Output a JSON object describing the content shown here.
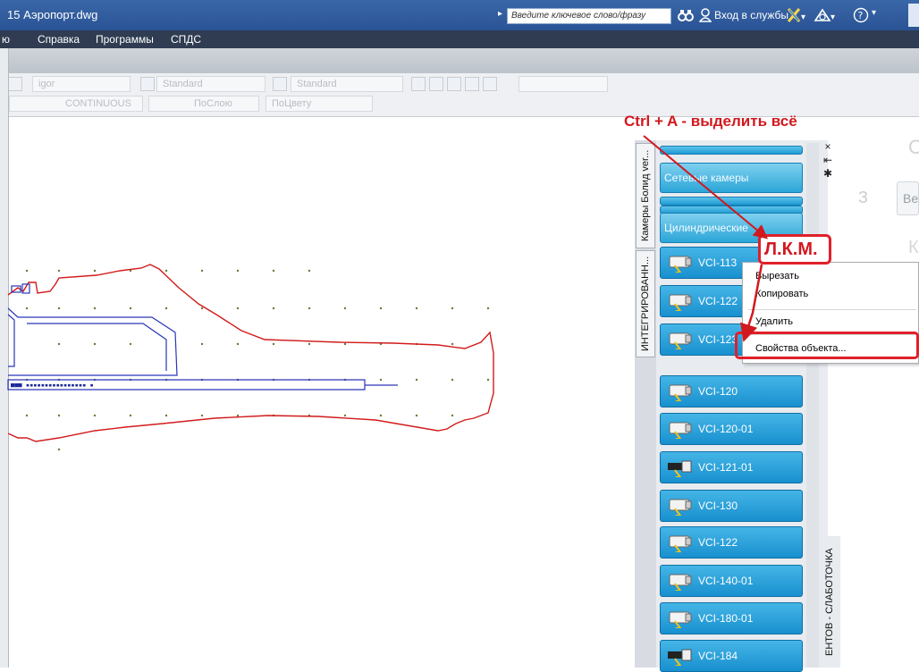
{
  "titlebar": {
    "title": "15   Аэропорт.dwg",
    "search_placeholder": "Введите ключевое слово/фразу",
    "login_label": "Вход в службы",
    "login_arrow": "▾",
    "help_arrow": "▾"
  },
  "menu": {
    "items": [
      "ю",
      "Справка",
      "Программы",
      "СПДС"
    ]
  },
  "toolbar": {
    "layer_value": "igor",
    "textstyle_value": "Standard",
    "dimstyle_value": "Standard",
    "linetype_value": "CONTINUOUS",
    "lineweight_value": "ПоСлою",
    "color_value": "ПоЦвету"
  },
  "annotations": {
    "ctrl_a": "Ctrl + A - выделить всё",
    "lkm": "Л.К.М."
  },
  "palette": {
    "vertical_tabs": [
      "Камеры Болид ver...",
      "ИНТЕГРИРОВАНН..."
    ],
    "bottom_tab": "ЕНТОВ - СЛАБОТОЧКА",
    "groups": [
      "Сетевые камеры",
      "Цилиндрические"
    ],
    "cameras": [
      "VCI-113",
      "VCI-122",
      "VCI-123",
      "VCI-120",
      "VCI-120-01",
      "VCI-121-01",
      "VCI-130",
      "VCI-122",
      "VCI-140-01",
      "VCI-180-01",
      "VCI-184"
    ],
    "controls": [
      "×",
      "⇤",
      "✱"
    ]
  },
  "context_menu": {
    "items": [
      "Вырезать",
      "Копировать",
      "Удалить",
      "Свойства объекта..."
    ]
  },
  "right_panel": {
    "c": "С",
    "three": "З",
    "be": "Ве",
    "k": "К"
  },
  "colors": {
    "accent_red": "#d2181f",
    "palette_blue": "#1f97d3",
    "title_blue": "#2f5c9c"
  }
}
